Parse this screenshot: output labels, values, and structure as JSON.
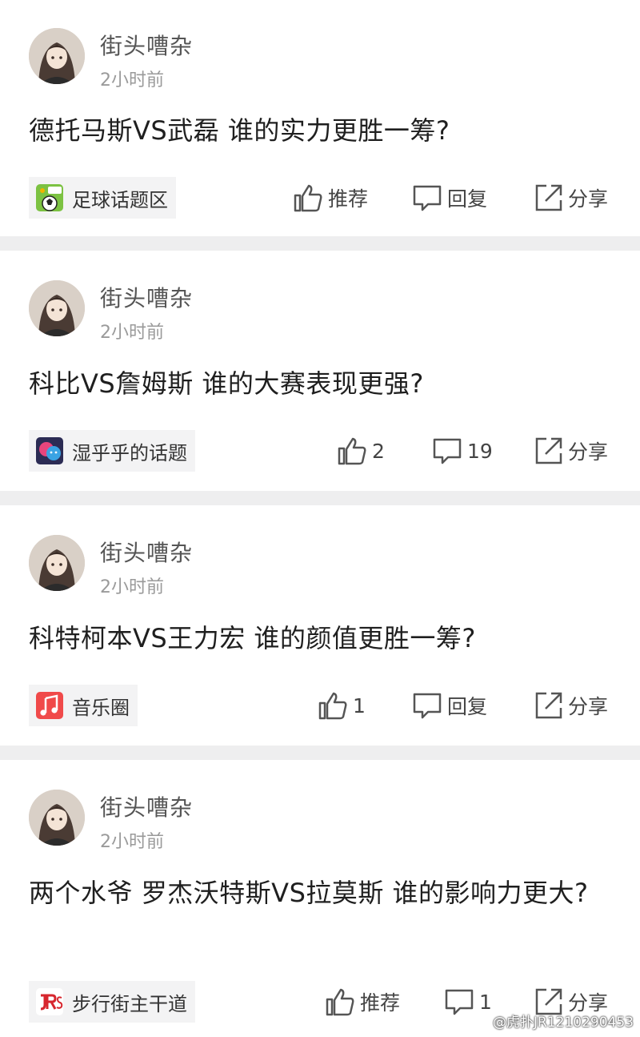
{
  "posts": [
    {
      "username": "街头嘈杂",
      "time": "2小时前",
      "title": "德托马斯VS武磊 谁的实力更胜一筹?",
      "tag": {
        "label": "足球话题区",
        "icon": "football-chat-icon"
      },
      "actions": {
        "like": "推荐",
        "reply": "回复",
        "share": "分享"
      }
    },
    {
      "username": "街头嘈杂",
      "time": "2小时前",
      "title": "科比VS詹姆斯 谁的大赛表现更强?",
      "tag": {
        "label": "湿乎乎的话题",
        "icon": "speech-bubbles-icon"
      },
      "actions": {
        "like": "2",
        "reply": "19",
        "share": "分享"
      }
    },
    {
      "username": "街头嘈杂",
      "time": "2小时前",
      "title": "科特柯本VS王力宏 谁的颜值更胜一筹?",
      "tag": {
        "label": "音乐圈",
        "icon": "music-note-icon"
      },
      "actions": {
        "like": "1",
        "reply": "回复",
        "share": "分享"
      }
    },
    {
      "username": "街头嘈杂",
      "time": "2小时前",
      "title": "两个水爷 罗杰沃特斯VS拉莫斯 谁的影响力更大?",
      "tag": {
        "label": "步行街主干道",
        "icon": "jrs-logo-icon"
      },
      "actions": {
        "like": "推荐",
        "reply": "1",
        "share": "分享"
      }
    }
  ],
  "watermark": "@虎扑JR1210290453",
  "colors": {
    "separator": "#eeeeef",
    "tag_bg": "#f3f3f4",
    "icon": "#555555"
  }
}
